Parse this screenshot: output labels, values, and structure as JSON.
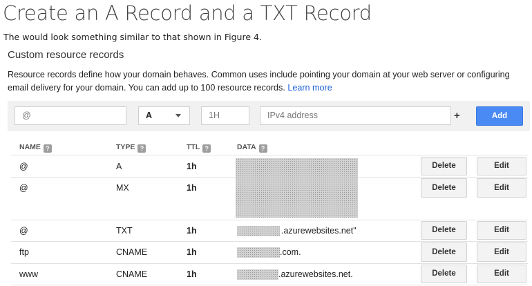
{
  "heading": "Create an A Record and a TXT Record",
  "intro": "The would look something similar to that shown in Figure 4.",
  "section": {
    "title": "Custom resource records",
    "description": "Resource records define how your domain behaves. Common uses include pointing your domain at your web server or configuring email delivery for your domain. You can add up to 100 resource records.",
    "learn_more": "Learn more"
  },
  "form": {
    "name_placeholder": "@",
    "type_value": "A",
    "ttl_placeholder": "1H",
    "data_placeholder": "IPv4 address",
    "plus": "+",
    "add_label": "Add"
  },
  "table": {
    "columns": [
      "NAME",
      "TYPE",
      "TTL",
      "DATA"
    ],
    "help_glyph": "?",
    "delete_label": "Delete",
    "edit_label": "Edit",
    "rows": [
      {
        "name": "@",
        "type": "A",
        "ttl": "1h",
        "data": ""
      },
      {
        "name": "@",
        "type": "MX",
        "ttl": "1h",
        "data": ""
      },
      {
        "name": "@",
        "type": "TXT",
        "ttl": "1h",
        "data": ".azurewebsites.net\""
      },
      {
        "name": "ftp",
        "type": "CNAME",
        "ttl": "1h",
        "data": ".com."
      },
      {
        "name": "www",
        "type": "CNAME",
        "ttl": "1h",
        "data": ".azurewebsites.net."
      }
    ]
  }
}
